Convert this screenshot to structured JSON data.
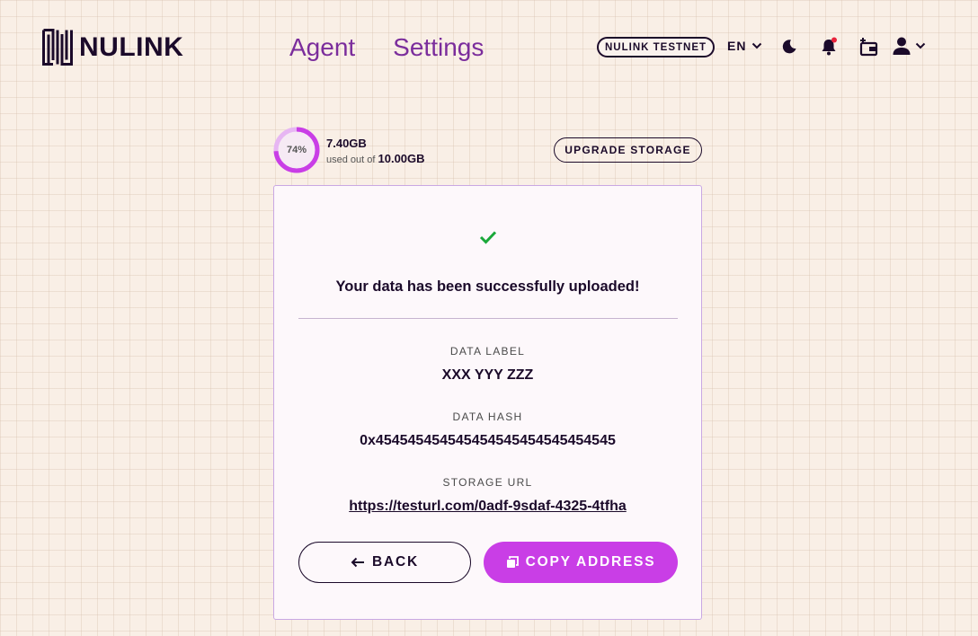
{
  "brand": {
    "name": "NULINK"
  },
  "nav": {
    "items": [
      {
        "label": "Agent"
      },
      {
        "label": "Settings"
      }
    ]
  },
  "header": {
    "network_badge": "NULINK TESTNET",
    "language": "EN",
    "icons": [
      "moon-icon",
      "bell-icon",
      "wallet-add-icon",
      "user-icon"
    ],
    "notification_dot_color": "#e8223b"
  },
  "storage": {
    "percent_label": "74%",
    "percent": 74,
    "used": "7.40GB",
    "used_out_of_text": "used out of",
    "total": "10.00GB",
    "upgrade_label": "UPGRADE STORAGE"
  },
  "result": {
    "title": "Your data has been successfully uploaded!",
    "data_label_heading": "DATA LABEL",
    "data_label_value": "XXX YYY ZZZ",
    "data_hash_heading": "DATA HASH",
    "data_hash_value": "0x454545454545454545454545454545",
    "storage_url_heading": "STORAGE URL",
    "storage_url_value": "https://testurl.com/0adf-9sdaf-4325-4tfha"
  },
  "actions": {
    "back_label": "BACK",
    "copy_label": "COPY ADDRESS"
  },
  "colors": {
    "accent": "#c93ee6",
    "nav": "#7b2d9c",
    "success": "#1aa83a",
    "ink": "#1b0a2a"
  }
}
